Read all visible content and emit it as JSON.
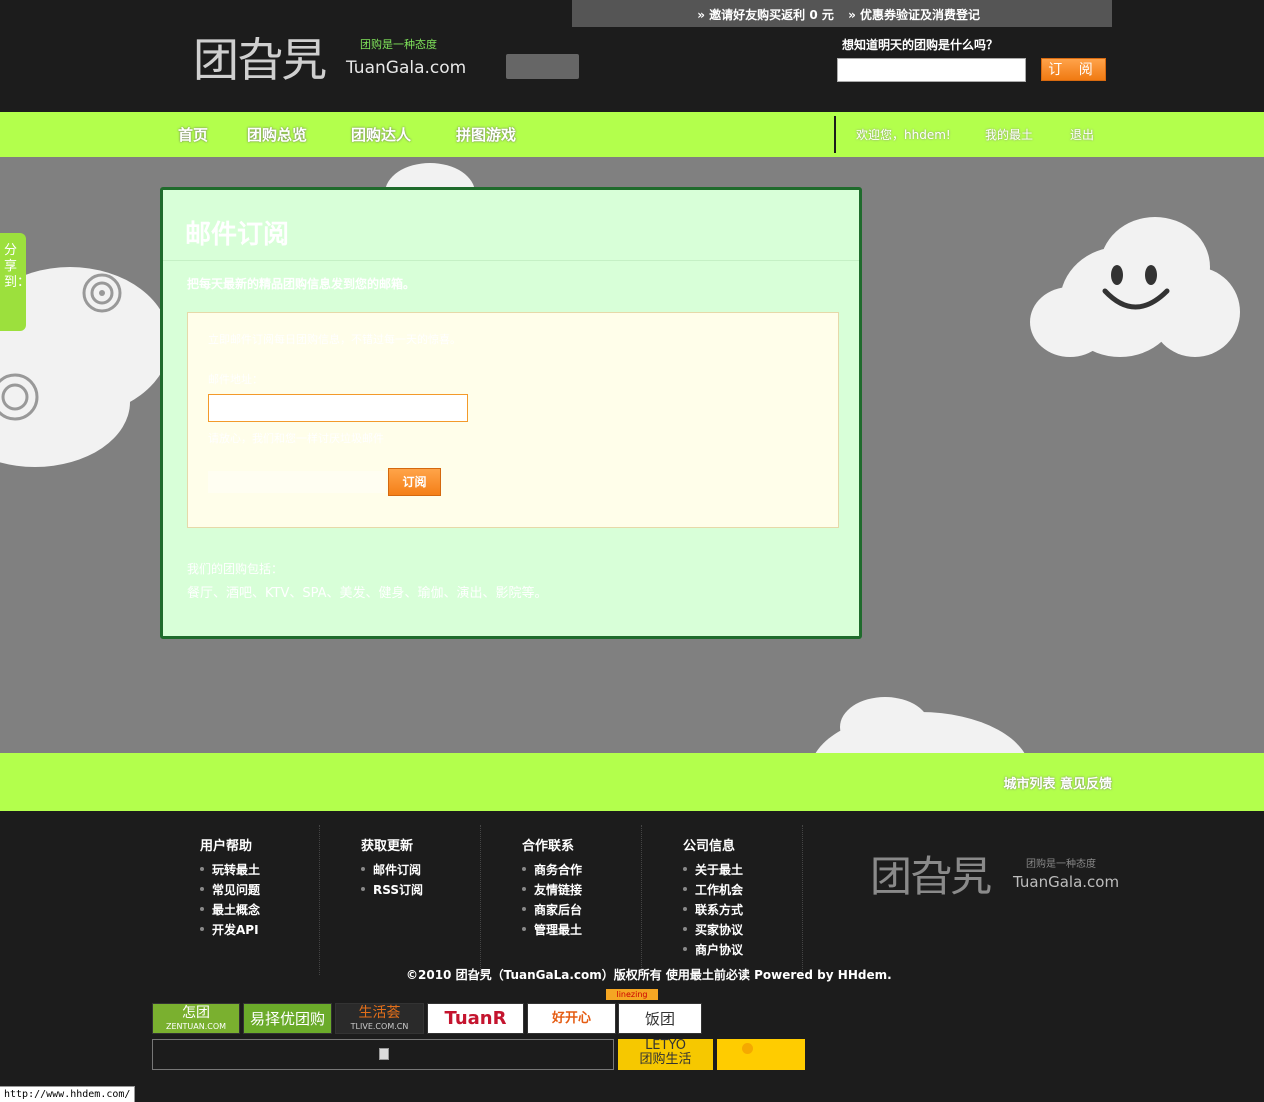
{
  "topbar": {
    "invite": "» 邀请好友购买返利 0 元",
    "coupon": "» 优惠券验证及消费登记"
  },
  "header": {
    "logo_cn": "团旮旯",
    "logo_slogan": "团购是一种态度",
    "logo_en": "TuanGala.com",
    "ask": "想知道明天的团购是什么吗？",
    "subscribe_label": "订 阅"
  },
  "nav": {
    "items": [
      "首页",
      "团购总览",
      "团购达人",
      "拼图游戏"
    ],
    "welcome": "欢迎您，hhdem!",
    "my_account": "我的最土",
    "logout": "退出"
  },
  "share": "分享到：",
  "card": {
    "title": "邮件订阅",
    "desc": "把每天最新的精品团购信息发到您的邮箱。",
    "tip": "立即邮件订阅每日团购信息，不错过每一天的惊喜。",
    "email_label": "邮件地址：",
    "hint": "请放心，我们和您一样讨厌垃圾邮件",
    "subscribe_btn": "订阅",
    "cat_title": "我们的团购包括：",
    "cats": "餐厅、酒吧、KTV、SPA、美发、健身、瑜伽、演出、影院等。"
  },
  "band": {
    "city_list": "城市列表",
    "feedback": "意见反馈"
  },
  "footer": {
    "cols": [
      {
        "title": "用户帮助",
        "items": [
          "玩转最土",
          "常见问题",
          "最土概念",
          "开发API"
        ]
      },
      {
        "title": "获取更新",
        "items": [
          "邮件订阅",
          "RSS订阅"
        ]
      },
      {
        "title": "合作联系",
        "items": [
          "商务合作",
          "友情链接",
          "商家后台",
          "管理最土"
        ]
      },
      {
        "title": "公司信息",
        "items": [
          "关于最土",
          "工作机会",
          "联系方式",
          "买家协议",
          "商户协议"
        ]
      }
    ],
    "copyright": "©2010 团旮旯（TuanGaLa.com）版权所有 使用最土前必读  Powered by HHdem."
  },
  "badges": {
    "b1": "怎团",
    "b1_sub": "ZENTUAN.COM",
    "b2": "易择优团购",
    "b3": "生活荟",
    "b3_sub": "TLIVE.COM.CN",
    "b4": "TuanR",
    "b5": "好开心 HaoKx.com",
    "b6": "饭团",
    "b6_tag": "linezing",
    "b7": "LETYO",
    "b7_sub": "团购生活"
  },
  "status_url": "http://www.hhdem.com/"
}
